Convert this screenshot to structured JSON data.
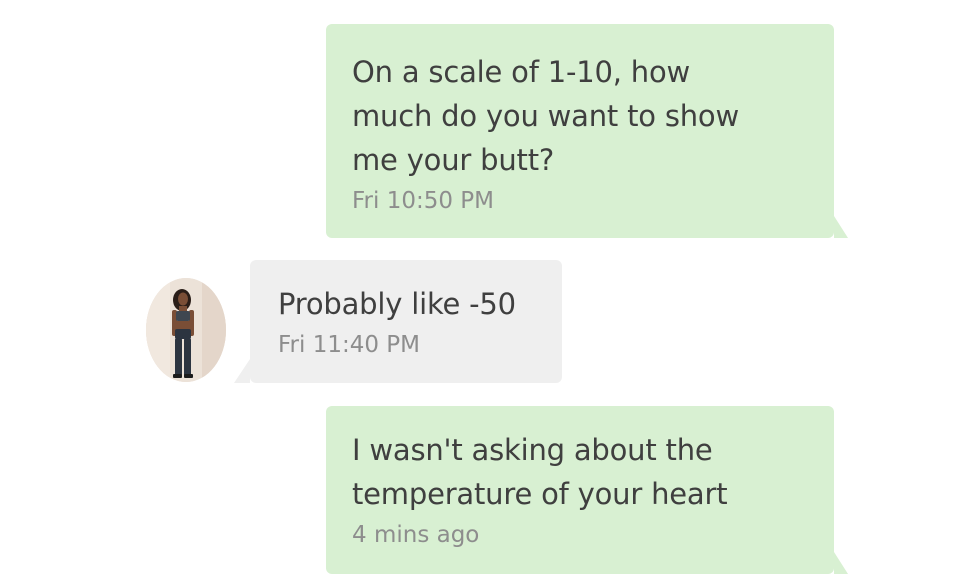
{
  "conversation": {
    "messages": [
      {
        "direction": "sent",
        "text": "On a scale of 1-10, how\nmuch do you want to show\nme your butt?",
        "time": "Fri  10:50 PM"
      },
      {
        "direction": "received",
        "text": "Probably like -50",
        "time": "Fri  11:40 PM"
      },
      {
        "direction": "sent",
        "text": "I wasn't asking about the\ntemperature of your heart",
        "time": "4 mins ago"
      }
    ]
  },
  "colors": {
    "sent_bubble": "#d8f0d2",
    "received_bubble": "#efefef",
    "message_text": "#3f3f3f",
    "timestamp_text": "#8d8d8d"
  }
}
